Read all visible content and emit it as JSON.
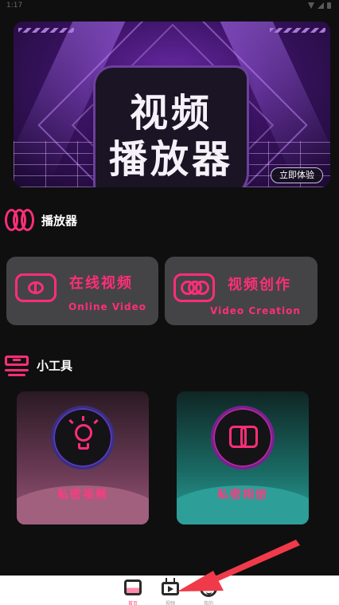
{
  "status_bar": {
    "time": "1:17"
  },
  "banner": {
    "title_line1": "视频",
    "title_line2": "播放器",
    "cta": "立即体验"
  },
  "player_section": {
    "title": "播放器",
    "cards": [
      {
        "title": "在线视频",
        "subtitle": "Online Video"
      },
      {
        "title": "视频创作",
        "subtitle": "Video Creation"
      }
    ]
  },
  "tools_section": {
    "title": "小工具",
    "cards": [
      {
        "label": "私密视频"
      },
      {
        "label": "私密相册"
      }
    ]
  },
  "bottom_nav": {
    "items": [
      {
        "label": "首页",
        "icon": "home-icon"
      },
      {
        "label": "视频",
        "icon": "tv-icon"
      },
      {
        "label": "我的",
        "icon": "profile-icon"
      }
    ]
  },
  "colors": {
    "accent": "#ff2e77",
    "background": "#0f0f10",
    "card": "#444446",
    "annotation_arrow": "#f03a4a"
  }
}
